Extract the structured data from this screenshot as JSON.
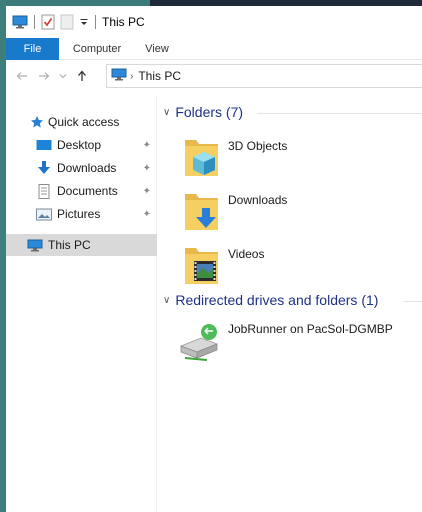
{
  "window": {
    "title": "This PC"
  },
  "quick_access_toolbar": {
    "icons": [
      "this-pc-icon",
      "properties-icon",
      "new-folder-icon",
      "customize-dropdown-icon"
    ]
  },
  "ribbon": {
    "tabs": [
      {
        "label": "File",
        "active": true
      },
      {
        "label": "Computer"
      },
      {
        "label": "View"
      }
    ]
  },
  "address_bar": {
    "path": [
      "This PC"
    ]
  },
  "nav_pane": {
    "quick_access_label": "Quick access",
    "items": [
      {
        "label": "Desktop",
        "icon": "desktop-icon",
        "pinned": true
      },
      {
        "label": "Downloads",
        "icon": "downloads-icon",
        "pinned": true
      },
      {
        "label": "Documents",
        "icon": "documents-icon",
        "pinned": true
      },
      {
        "label": "Pictures",
        "icon": "pictures-icon",
        "pinned": true
      }
    ],
    "this_pc_label": "This PC"
  },
  "content": {
    "folders_group": {
      "title": "Folders (7)"
    },
    "folders": [
      {
        "label": "3D Objects",
        "icon": "3d-objects-folder-icon"
      },
      {
        "label": "Downloads",
        "icon": "downloads-folder-icon"
      },
      {
        "label": "Videos",
        "icon": "videos-folder-icon"
      }
    ],
    "drives_group": {
      "title": "Redirected drives and folders (1)"
    },
    "drives": [
      {
        "label": "JobRunner on PacSol-DGMBP",
        "icon": "network-drive-icon"
      }
    ]
  },
  "colors": {
    "file_tab": "#1979ca",
    "group_header": "#1e3287",
    "selected_nav": "#d9d9d9",
    "desktop": "#3b7a78"
  }
}
